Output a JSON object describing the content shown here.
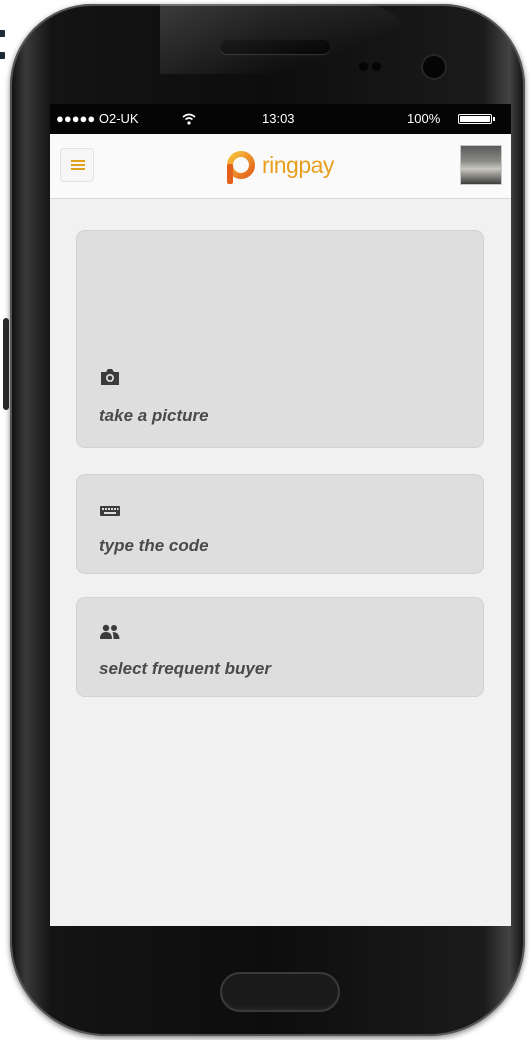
{
  "status_bar": {
    "carrier": "●●●●● O2-UK",
    "time": "13:03",
    "battery_percent": "100%"
  },
  "app_bar": {
    "logo_text": "ringpay",
    "brand_color": "#e8a020"
  },
  "actions": [
    {
      "label": "take a picture",
      "icon": "camera-icon"
    },
    {
      "label": "type the code",
      "icon": "keyboard-icon"
    },
    {
      "label": "select frequent buyer",
      "icon": "users-icon"
    }
  ]
}
